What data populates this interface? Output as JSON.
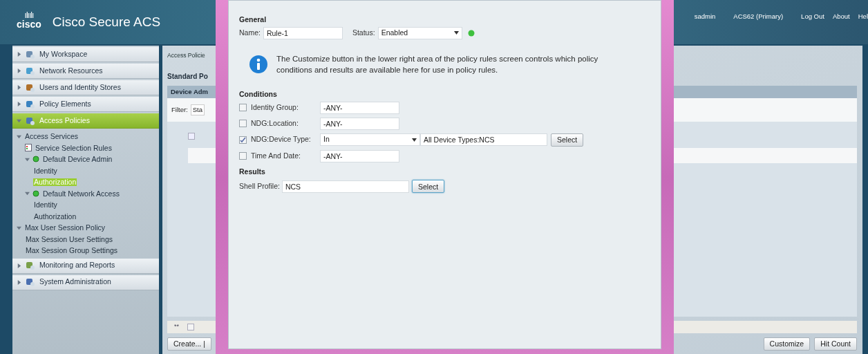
{
  "header": {
    "logo_mark": "ılıılı",
    "logo_text": "cisco",
    "product": "Cisco Secure ACS",
    "user": "sadmin",
    "server": "ACS62 (Primary)",
    "links": [
      "Log Out",
      "About",
      "Hel"
    ]
  },
  "sidebar": {
    "items": [
      {
        "label": "My Workspace",
        "selected": false,
        "expanded": false
      },
      {
        "label": "Network Resources",
        "selected": false,
        "expanded": false
      },
      {
        "label": "Users and Identity Stores",
        "selected": false,
        "expanded": false
      },
      {
        "label": "Policy Elements",
        "selected": false,
        "expanded": false
      },
      {
        "label": "Access Policies",
        "selected": true,
        "expanded": true,
        "children": [
          {
            "label": "Access Services",
            "kind": "branch",
            "expanded": true,
            "selected": false,
            "children": [
              {
                "label": "Service Selection Rules",
                "kind": "rules",
                "selected": false
              },
              {
                "label": "Default Device Admin",
                "kind": "service",
                "expanded": true,
                "selected": false,
                "children": [
                  {
                    "label": "Identity",
                    "kind": "leaf",
                    "selected": false
                  },
                  {
                    "label": "Authorization",
                    "kind": "leaf",
                    "selected": true
                  }
                ]
              },
              {
                "label": "Default Network Access",
                "kind": "service",
                "expanded": true,
                "selected": false,
                "children": [
                  {
                    "label": "Identity",
                    "kind": "leaf",
                    "selected": false
                  },
                  {
                    "label": "Authorization",
                    "kind": "leaf",
                    "selected": false
                  }
                ]
              }
            ]
          },
          {
            "label": "Max User Session Policy",
            "kind": "branch",
            "expanded": true,
            "selected": false,
            "children": [
              {
                "label": "Max Session User Settings",
                "kind": "leaf",
                "selected": false
              },
              {
                "label": "Max Session Group Settings",
                "kind": "leaf",
                "selected": false
              }
            ]
          }
        ]
      },
      {
        "label": "Monitoring and Reports",
        "selected": false,
        "expanded": false
      },
      {
        "label": "System Administration",
        "selected": false,
        "expanded": false
      }
    ]
  },
  "content": {
    "breadcrumb": "Access Policie",
    "title": "Standard Po",
    "table_tab": "Device Adm",
    "filter_label": "Filter:",
    "filter_value": "Sta",
    "row_checked": false,
    "footer_checked": false,
    "footer_mark": "**",
    "create_button": "Create... |",
    "buttons": [
      "Customize",
      "Hit Count"
    ]
  },
  "dialog": {
    "general": {
      "heading": "General",
      "name_label": "Name:",
      "name_value": "Rule-1",
      "status_label": "Status:",
      "status_value": "Enabled",
      "status_on": true
    },
    "info": "The Customize button in the lower right area of the policy rules screen controls which policy conditions and results are available here for use in policy rules.",
    "conditions": {
      "heading": "Conditions",
      "rows": [
        {
          "kind": "text",
          "label": "Identity Group:",
          "checked": false,
          "value": "-ANY-"
        },
        {
          "kind": "text",
          "label": "NDG:Location:",
          "checked": false,
          "value": "-ANY-"
        },
        {
          "kind": "select",
          "label": "NDG:Device Type:",
          "checked": true,
          "operator": "In",
          "value": "All Device Types:NCS",
          "button": "Select"
        },
        {
          "kind": "text",
          "label": "Time And Date:",
          "checked": false,
          "value": "-ANY-"
        }
      ]
    },
    "results": {
      "heading": "Results",
      "label": "Shell Profile:",
      "value": "NCS",
      "button": "Select"
    }
  }
}
